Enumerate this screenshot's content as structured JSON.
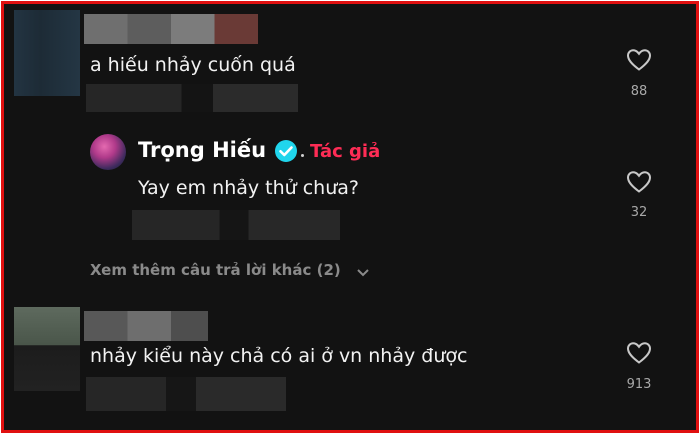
{
  "comments": [
    {
      "text": "a hiếu nhảy cuốn quá",
      "likes": "88"
    },
    {
      "author": "Trọng Hiếu",
      "author_badge": "Tác giả",
      "text": "Yay em nhảy thử chưa?",
      "likes": "32"
    },
    {
      "text": "nhảy kiểu này chả có ai ở vn nhảy được",
      "likes": "913"
    }
  ],
  "more_replies": "Xem thêm câu trả lời khác (2)",
  "icons": {
    "like": "heart-icon",
    "verified": "verified-badge-icon",
    "expand": "chevron-down-icon"
  },
  "colors": {
    "background": "#121212",
    "author_badge": "#fe2c55",
    "verified": "#20d5ec",
    "frame": "#e01010"
  }
}
